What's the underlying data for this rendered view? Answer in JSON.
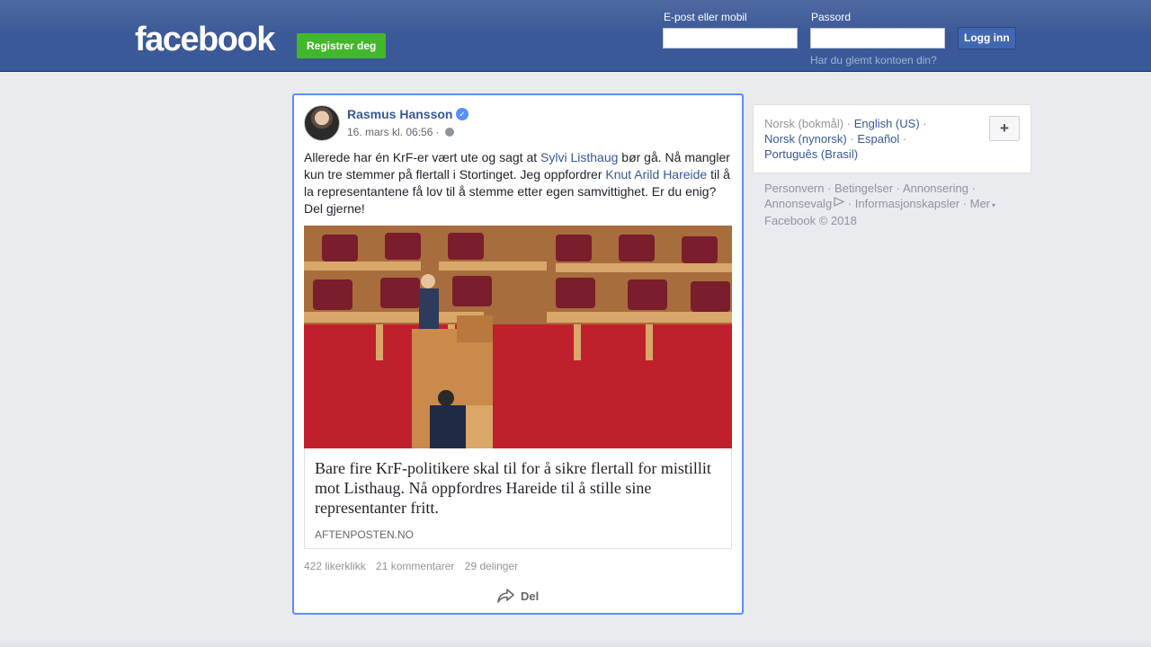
{
  "header": {
    "logo": "facebook",
    "register_label": "Registrer deg",
    "email_label": "E-post eller mobil",
    "password_label": "Passord",
    "login_label": "Logg inn",
    "forgot_label": "Har du glemt kontoen din?"
  },
  "post": {
    "author": "Rasmus Hansson",
    "timestamp": "16. mars kl. 06:56",
    "meta_separator": "·",
    "text_parts": {
      "p1": "Allerede har én KrF-er vært ute og sagt at ",
      "link1": "Sylvi Listhaug",
      "p2": " bør gå. Nå mangler kun tre stemmer på flertall i Stortinget. Jeg oppfordrer ",
      "link2": "Knut Arild Hareide",
      "p3": " til å la representantene få lov til å stemme etter egen samvittighet. Er du enig? Del gjerne!"
    },
    "link_title": "Bare fire KrF-politikere skal til for å sikre flertall for mistillit mot Listhaug. Nå oppfordres Hareide til å stille sine representanter fritt.",
    "link_domain": "AFTENPOSTEN.NO",
    "stats": {
      "likes": "422 likerklikk",
      "comments": "21 kommentarer",
      "shares": "29 delinger"
    },
    "share_label": "Del"
  },
  "sidebar": {
    "languages": {
      "current": "Norsk (bokmål)",
      "items": [
        "English (US)",
        "Norsk (nynorsk)",
        "Español",
        "Português (Brasil)"
      ]
    },
    "plus_label": "+",
    "footer_links": [
      "Personvern",
      "Betingelser",
      "Annonsering",
      "Annonsevalg",
      "Informasjonskapsler",
      "Mer"
    ],
    "copyright": "Facebook © 2018"
  },
  "colors": {
    "brand_blue": "#3b5998",
    "link_blue": "#365899",
    "register_green": "#42b72a",
    "post_highlight": "#5890ff"
  },
  "icons": {
    "verified": "verified-badge-icon",
    "globe": "globe-icon",
    "share": "share-arrow-icon",
    "ad_choices": "ad-choices-icon",
    "dropdown": "chevron-down-icon"
  }
}
